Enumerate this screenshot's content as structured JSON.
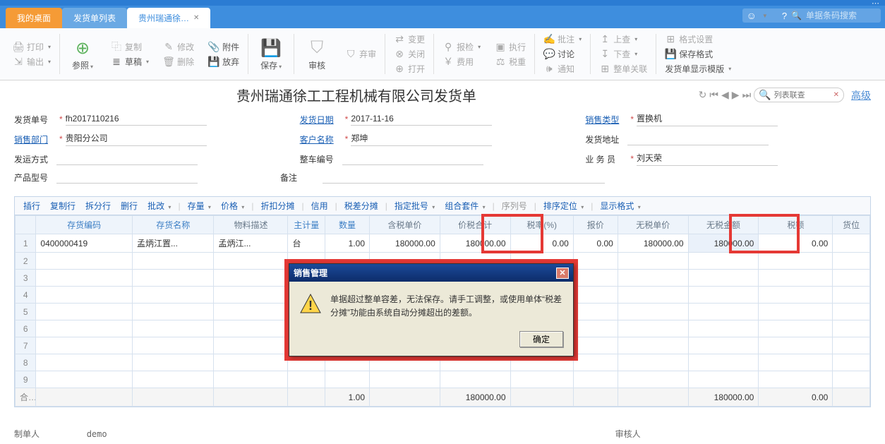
{
  "topbar": {
    "search_placeholder": "单据条码搜索"
  },
  "tabs": {
    "desktop": "我的桌面",
    "list": "发货单列表",
    "active": "贵州瑞通徐…"
  },
  "toolbar": {
    "print": "打印",
    "output": "输出",
    "ref": "参照",
    "copy": "复制",
    "draft": "草稿",
    "delete": "删除",
    "modify": "修改",
    "attach": "附件",
    "abandon": "放弃",
    "save": "保存",
    "audit": "审核",
    "unaudit": "弃审",
    "change": "变更",
    "close": "关闭",
    "open": "打开",
    "recheck": "报检",
    "exec": "执行",
    "cost": "费用",
    "tax": "税重",
    "batch": "批注",
    "discuss": "讨论",
    "notify": "通知",
    "up": "上查",
    "down": "下查",
    "related": "整单关联",
    "format": "格式设置",
    "savefmt": "保存格式",
    "display": "发货单显示模版"
  },
  "doc": {
    "title": "贵州瑞通徐工工程机械有限公司发货单",
    "search_placeholder": "列表联查",
    "advanced": "高级"
  },
  "form": {
    "labels": {
      "docno": "发货单号",
      "dept": "销售部门",
      "shipway": "发运方式",
      "model": "产品型号",
      "date": "发货日期",
      "customer": "客户名称",
      "vehno": "整车编号",
      "remark": "备注",
      "saletype": "销售类型",
      "shipaddr": "发货地址",
      "salesman": "业 务 员"
    },
    "values": {
      "docno": "fh2017110216",
      "dept": "贵阳分公司",
      "date": "2017-11-16",
      "customer": "郑坤",
      "saletype": "置换机",
      "salesman": "刘天荣"
    }
  },
  "gridbar": {
    "insert": "插行",
    "copyrow": "复制行",
    "splitrow": "拆分行",
    "delrow": "删行",
    "batchchg": "批改",
    "stock": "存量",
    "price": "价格",
    "discount": "折扣分摊",
    "credit": "信用",
    "taxsplit": "税差分摊",
    "assign": "指定批号",
    "combo": "组合套件",
    "serial": "序列号",
    "sort": "排序定位",
    "dispfmt": "显示格式"
  },
  "headers": {
    "code": "存货编码",
    "name": "存货名称",
    "mat": "物料描述",
    "main": "主计量",
    "qty": "数量",
    "tprice": "含税单价",
    "ttotal": "价税合计",
    "rate": "税率(%)",
    "rprice": "报价",
    "nprice": "无税单价",
    "namount": "无税金额",
    "tax": "税额",
    "loc": "货位"
  },
  "rows": [
    {
      "code": "0400000419",
      "name": "孟炳江置...",
      "mat": "孟炳江...",
      "main": "台",
      "qty": "1.00",
      "tprice": "180000.00",
      "ttotal": "180000.00",
      "rate": "0.00",
      "rprice": "0.00",
      "nprice": "180000.00",
      "namount": "180000.00",
      "tax": "0.00"
    }
  ],
  "totals": {
    "label": "合计",
    "qty": "1.00",
    "ttotal": "180000.00",
    "namount": "180000.00",
    "tax": "0.00"
  },
  "dialog": {
    "title": "销售管理",
    "message": "单据超过整单容差，无法保存。请手工调整，或使用单体“税差分摊”功能由系统自动分摊超出的差额。",
    "ok": "确定"
  },
  "footer": {
    "maker_label": "制单人",
    "maker": "demo",
    "auditor_label": "审核人"
  }
}
